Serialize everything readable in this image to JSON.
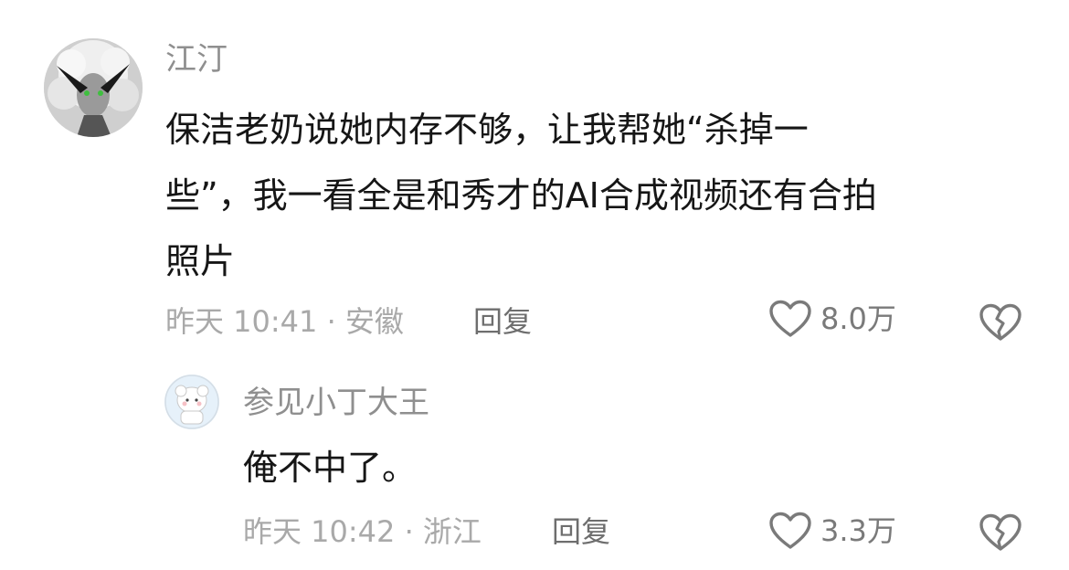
{
  "comments": [
    {
      "author": "江汀",
      "content_lines": [
        "保洁老奶说她内存不够，让我帮她“杀掉一",
        "些”，我一看全是和秀才的AI合成视频还有合拍",
        "照片"
      ],
      "time_location": "昨天 10:41 · 安徽",
      "reply_label": "回复",
      "like_count": "8.0万",
      "like_icon": "heart-outline-icon",
      "dislike_icon": "broken-heart-icon"
    },
    {
      "author": "参见小丁大王",
      "content_lines": [
        "俺不中了。"
      ],
      "time_location": "昨天 10:42 · 浙江",
      "reply_label": "回复",
      "like_count": "3.3万",
      "like_icon": "heart-outline-icon",
      "dislike_icon": "broken-heart-icon"
    }
  ],
  "colors": {
    "author": "#8f8f8f",
    "content": "#161616",
    "meta": "#a9a9a9",
    "reply": "#6e6e6e",
    "icon": "#7a7a7a"
  }
}
